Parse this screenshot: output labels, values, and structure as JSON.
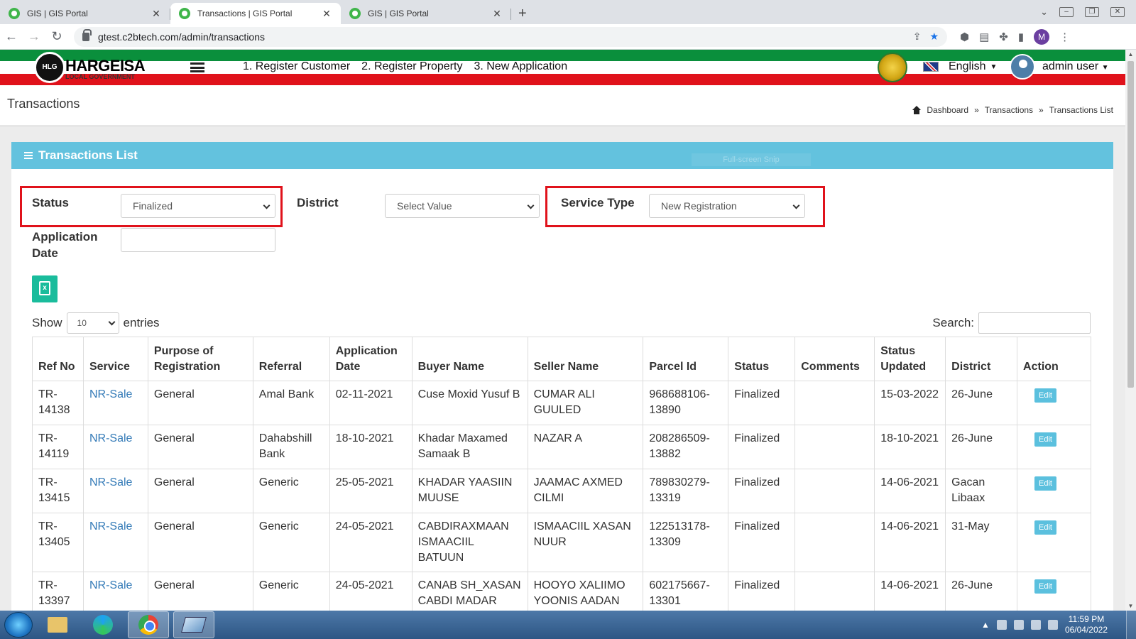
{
  "browser": {
    "tabs": [
      {
        "title": "GIS | GIS Portal",
        "active": false
      },
      {
        "title": "Transactions | GIS Portal",
        "active": true
      },
      {
        "title": "GIS | GIS Portal",
        "active": false
      }
    ],
    "url": "gtest.c2btech.com/admin/transactions",
    "profile_initial": "M"
  },
  "header": {
    "logo_text": "HARGEISA",
    "logo_subtext": "LOCAL GOVERNMENT",
    "logo_mark": "HLG",
    "links": [
      "1. Register Customer",
      "2. Register Property",
      "3. New Application"
    ],
    "language": "English",
    "user": "admin user"
  },
  "page": {
    "title": "Transactions",
    "breadcrumb": [
      "Dashboard",
      "Transactions",
      "Transactions List"
    ],
    "breadcrumb_sep": "»"
  },
  "panel": {
    "title": "Transactions List",
    "ghost_text": "Full-screen Snip"
  },
  "filters": {
    "status_label": "Status",
    "status_value": "Finalized",
    "district_label": "District",
    "district_value": "Select Value",
    "service_type_label": "Service Type",
    "service_type_value": "New Registration",
    "application_date_label_1": "Application",
    "application_date_label_2": "Date",
    "application_date_value": ""
  },
  "table_controls": {
    "show_label": "Show",
    "show_value": "10",
    "entries_label": "entries",
    "search_label": "Search:"
  },
  "table": {
    "columns": [
      "Ref No",
      "Service",
      "Purpose of Registration",
      "Referral",
      "Application Date",
      "Buyer Name",
      "Seller Name",
      "Parcel Id",
      "Status",
      "Comments",
      "Status Updated",
      "District",
      "Action"
    ],
    "edit_label": "Edit",
    "rows": [
      {
        "ref": "TR-14138",
        "service": "NR-Sale",
        "purpose": "General",
        "referral": "Amal Bank",
        "app_date": "02-11-2021",
        "buyer": "Cuse Moxid Yusuf B",
        "seller": "CUMAR ALI GUULED",
        "parcel": "968688106-13890",
        "status": "Finalized",
        "comments": "",
        "updated": "15-03-2022",
        "district": "26-June"
      },
      {
        "ref": "TR-14119",
        "service": "NR-Sale",
        "purpose": "General",
        "referral": "Dahabshill Bank",
        "app_date": "18-10-2021",
        "buyer": "Khadar Maxamed Samaak B",
        "seller": "NAZAR A",
        "parcel": "208286509-13882",
        "status": "Finalized",
        "comments": "",
        "updated": "18-10-2021",
        "district": "26-June"
      },
      {
        "ref": "TR-13415",
        "service": "NR-Sale",
        "purpose": "General",
        "referral": "Generic",
        "app_date": "25-05-2021",
        "buyer": "KHADAR YAASIIN MUUSE",
        "seller": "JAAMAC AXMED CILMI",
        "parcel": "789830279-13319",
        "status": "Finalized",
        "comments": "",
        "updated": "14-06-2021",
        "district": "Gacan Libaax"
      },
      {
        "ref": "TR-13405",
        "service": "NR-Sale",
        "purpose": "General",
        "referral": "Generic",
        "app_date": "24-05-2021",
        "buyer": "CABDIRAXMAAN ISMAACIIL BATUUN",
        "seller": "ISMAACIIL XASAN NUUR",
        "parcel": "122513178-13309",
        "status": "Finalized",
        "comments": "",
        "updated": "14-06-2021",
        "district": "31-May"
      },
      {
        "ref": "TR-13397",
        "service": "NR-Sale",
        "purpose": "General",
        "referral": "Generic",
        "app_date": "24-05-2021",
        "buyer": "CANAB SH_XASAN CABDI MADAR",
        "seller": "HOOYO XALIIMO YOONIS AADAN",
        "parcel": "602175667-13301",
        "status": "Finalized",
        "comments": "",
        "updated": "14-06-2021",
        "district": "26-June"
      }
    ]
  },
  "taskbar": {
    "time": "11:59 PM",
    "date": "06/04/2022"
  },
  "colors": {
    "panel_header": "#63c2de",
    "highlight": "#e0121b",
    "link": "#337ab7",
    "edit_button": "#5bc0de",
    "excel_button": "#1abc9c"
  }
}
